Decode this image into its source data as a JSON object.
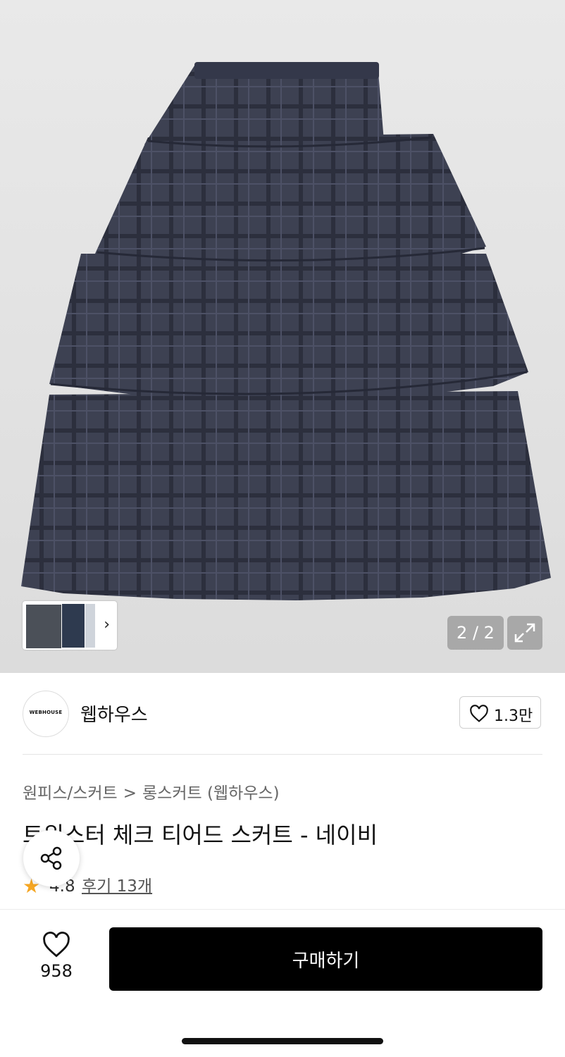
{
  "gallery": {
    "counter": "2 / 2",
    "thumbnail_next_icon": "chevron-right-icon",
    "expand_icon": "expand-icon"
  },
  "brand": {
    "logo_text": "WEBHOUSE",
    "name": "웹하우스",
    "likes": "1.3만"
  },
  "breadcrumb": {
    "category": "원피스/스커트",
    "separator": ">",
    "subcategory": "롱스커트 (웹하우스)"
  },
  "product": {
    "title": "트위스터 체크 티어드 스커트 - 네이비",
    "rating": "4.8",
    "reviews": "후기 13개"
  },
  "bottom_bar": {
    "wish_count": "958",
    "buy_label": "구매하기"
  },
  "colors": {
    "skirt": "#3a3e4f",
    "rating_star": "#f5a623",
    "buy_button": "#000000"
  }
}
